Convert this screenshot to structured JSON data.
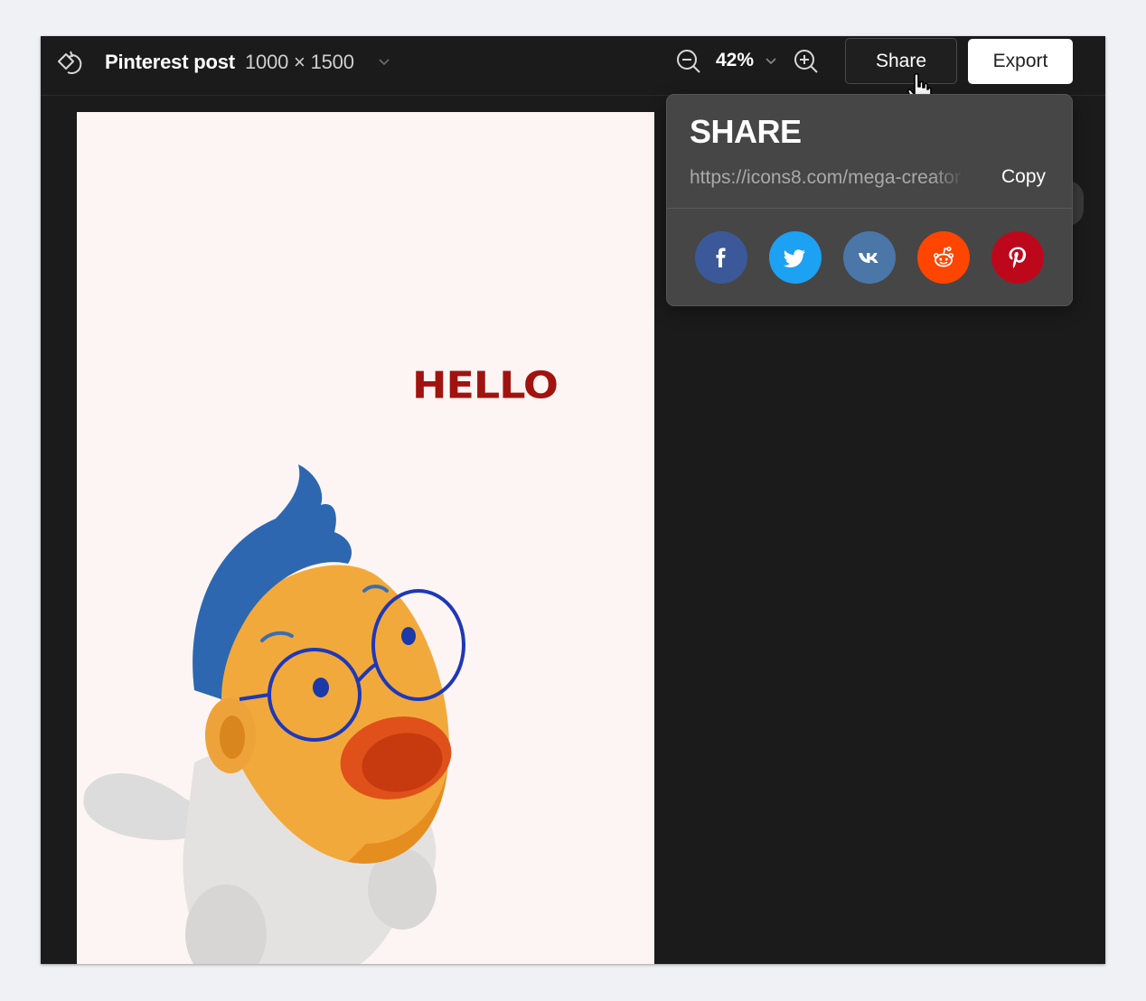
{
  "header": {
    "doc_title": "Pinterest post",
    "doc_size": "1000 × 1500",
    "zoom": "42%",
    "share_label": "Share",
    "export_label": "Export"
  },
  "artboard": {
    "headline": "HELLO",
    "background": "#fdf5f3",
    "headline_color": "#a1130f"
  },
  "share_popover": {
    "title": "SHARE",
    "url": "https://icons8.com/mega-creator",
    "copy_label": "Copy",
    "networks": [
      {
        "name": "facebook",
        "color": "#3b5998"
      },
      {
        "name": "twitter",
        "color": "#1da1f2"
      },
      {
        "name": "vk",
        "color": "#4a76a8"
      },
      {
        "name": "reddit",
        "color": "#ff4500"
      },
      {
        "name": "pinterest",
        "color": "#bd081c"
      }
    ]
  },
  "icons": [
    "reset-icon",
    "chevron-down-icon",
    "zoom-out-icon",
    "zoom-in-icon",
    "hand-cursor-icon",
    "facebook-icon",
    "twitter-icon",
    "vk-icon",
    "reddit-icon",
    "pinterest-icon"
  ]
}
